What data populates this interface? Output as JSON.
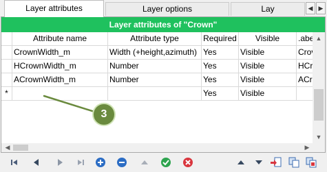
{
  "tabs": [
    {
      "label": "Layer attributes",
      "active": true
    },
    {
      "label": "Layer options",
      "active": false
    },
    {
      "label": "Lay",
      "active": false
    }
  ],
  "tab_scroll": {
    "left_icon": "triangle-left-icon",
    "right_icon": "triangle-right-icon"
  },
  "panel": {
    "title": "Layer attributes of \"Crown\"",
    "title_color": "#1fc15e"
  },
  "table": {
    "columns": [
      "",
      "Attribute name",
      "Attribute type",
      "Required",
      "Visible",
      ".abe"
    ],
    "rows": [
      {
        "marker": "",
        "name": "CrownWidth_m",
        "type": "Width (+height,azimuth)",
        "required": "Yes",
        "visible": "Visible",
        "label": "Crov"
      },
      {
        "marker": "",
        "name": "HCrownWidth_m",
        "type": "Number",
        "required": "Yes",
        "visible": "Visible",
        "label": "HCr"
      },
      {
        "marker": "",
        "name": "ACrownWidth_m",
        "type": "Number",
        "required": "Yes",
        "visible": "Visible",
        "label": "ACr"
      },
      {
        "marker": "*",
        "name": "",
        "type": "",
        "required": "Yes",
        "visible": "Visible",
        "label": ""
      }
    ]
  },
  "callout": {
    "number": "3",
    "color": "#6a8a3e"
  },
  "toolbar": {
    "buttons": [
      "first-record-icon",
      "previous-record-icon",
      "next-record-icon",
      "last-record-icon",
      "add-icon",
      "remove-icon",
      "move-up-icon",
      "confirm-icon",
      "cancel-icon",
      "sort-up-icon",
      "sort-down-icon",
      "import-icon",
      "copy-icon",
      "copy-export-icon"
    ]
  }
}
